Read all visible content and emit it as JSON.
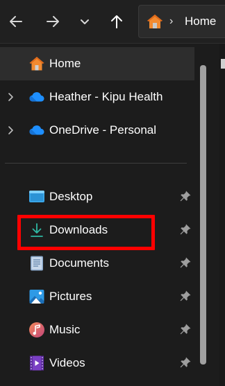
{
  "toolbar": {
    "back_icon": "arrow-left-icon",
    "forward_icon": "arrow-right-icon",
    "recent_icon": "chevron-down-icon",
    "up_icon": "arrow-up-icon",
    "address": {
      "icon": "home-icon",
      "separator": "›",
      "text": "Home"
    }
  },
  "nav": {
    "quick": [
      {
        "label": "Home",
        "icon": "home-icon",
        "selected": true,
        "expandable": false
      },
      {
        "label": "Heather - Kipu Health",
        "icon": "cloud-icon",
        "selected": false,
        "expandable": true
      },
      {
        "label": "OneDrive - Personal",
        "icon": "cloud-icon",
        "selected": false,
        "expandable": true
      }
    ],
    "pinned": [
      {
        "label": "Desktop",
        "icon": "desktop-icon",
        "pinned": true
      },
      {
        "label": "Downloads",
        "icon": "download-icon",
        "pinned": true
      },
      {
        "label": "Documents",
        "icon": "documents-icon",
        "pinned": true
      },
      {
        "label": "Pictures",
        "icon": "pictures-icon",
        "pinned": true
      },
      {
        "label": "Music",
        "icon": "music-icon",
        "pinned": true
      },
      {
        "label": "Videos",
        "icon": "videos-icon",
        "pinned": true
      }
    ]
  },
  "colors": {
    "background": "#1c1c1c",
    "toolbar": "#202020",
    "selected": "#2d2d2d",
    "highlight": "#ff0000",
    "home_orange": "#f28a30",
    "cloud_blue": "#1e90ff",
    "download_teal": "#2fb9a4"
  },
  "highlighted_item": "Downloads"
}
